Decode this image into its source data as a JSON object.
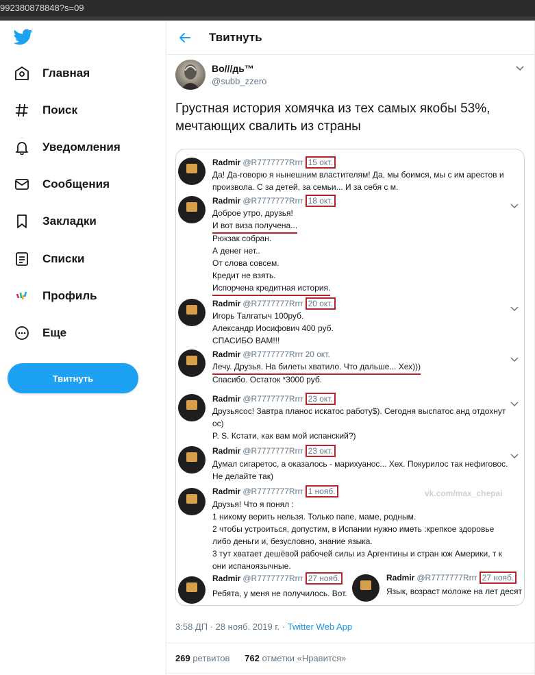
{
  "browser": {
    "url_fragment": "992380878848?s=09"
  },
  "sidebar": {
    "items": [
      {
        "label": "Главная",
        "icon": "home-icon"
      },
      {
        "label": "Поиск",
        "icon": "hashtag-icon"
      },
      {
        "label": "Уведомления",
        "icon": "bell-icon"
      },
      {
        "label": "Сообщения",
        "icon": "envelope-icon"
      },
      {
        "label": "Закладки",
        "icon": "bookmark-icon"
      },
      {
        "label": "Списки",
        "icon": "list-icon"
      },
      {
        "label": "Профиль",
        "icon": "profile-avatar-icon"
      },
      {
        "label": "Еще",
        "icon": "more-circle-icon"
      }
    ],
    "tweet_button": "Твитнуть"
  },
  "header": {
    "title": "Твитнуть"
  },
  "tweet": {
    "author_name": "Во///дь™",
    "author_handle": "@subb_zzero",
    "text": "Грустная история хомячка из тех самых якобы 53%, мечтающих свалить из страны",
    "timestamp": "3:58 ДП · 28 нояб. 2019 г. · ",
    "source": "Twitter Web App",
    "retweets_count": "269",
    "retweets_label": "ретвитов",
    "likes_count": "762",
    "likes_label": "отметки «Нравится»"
  },
  "screenshot": {
    "name": "Radmir",
    "handle": "@R7777777Rrrr",
    "watermark": "vk.com/max_chepai",
    "posts": [
      {
        "date": "15 окт.",
        "lines": [
          "Да! Да-говорю я нынешним властителям! Да, мы боимся, мы с   им арестов и",
          "произвола. С     за детей, за семьи... И за себя с  м."
        ]
      },
      {
        "date": "18 окт.",
        "lines": [
          "Доброе утро, друзья!",
          "И вот виза получена...",
          "Рюкзак собран.",
          "А денег нет..",
          "От слова совсем.",
          "Кредит не взять.",
          "Испорчена кредитная история."
        ]
      },
      {
        "date": "20 окт.",
        "lines": [
          "Игорь Талгатыч 100руб.",
          "Александр Иосифович 400 руб.",
          "СПАСИБО ВАМ!!!"
        ]
      },
      {
        "date": "20 окт.",
        "lines": [
          "Лечу. Друзья. На билеты хватило. Что дальше... Хех)))",
          "Спасибо. Остаток *3000 руб."
        ]
      },
      {
        "date": "23 окт.",
        "lines": [
          "Друзьясос! Завтра планос искатос работу$). Сегодня выспатос анд отдохнут",
          "ос)",
          "P. S. Кстати, как вам мой испанский?)"
        ]
      },
      {
        "date": "23 окт.",
        "lines": [
          "Думал сигаретос, а оказалось - марихуанос... Хех. Покурилос так нефиговос.",
          "Не делайте так)"
        ]
      },
      {
        "date": "1 нояб.",
        "lines": [
          "Друзья! Что я понял :",
          "1 никому верить нельзя.  Только папе, маме, родным.",
          "2 чтобы устроиться, допустим, в Испании нужно иметь :крепкое здоровье",
          "либо деньги и, безусловно, знание языка.",
          "3 тут хватает дешёвой рабочей силы из Аргентины и стран юж Америки, т к",
          "они испаноязычные."
        ]
      },
      {
        "date": "27 нояб.",
        "lines": [
          "Ребята, у меня не получилось. Вот."
        ]
      },
      {
        "date": "27 нояб.",
        "lines": [
          "Язык, возраст моложе на лет десят"
        ]
      }
    ]
  },
  "colors": {
    "accent": "#1da1f2",
    "highlight_red": "#b5232d",
    "secondary_text": "#657786"
  }
}
